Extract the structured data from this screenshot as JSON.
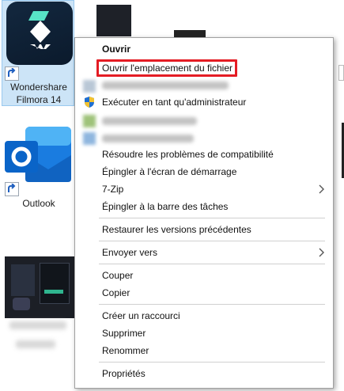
{
  "desktop": {
    "filmora": {
      "label_line1": "Wondershare",
      "label_line2": "Filmora 14"
    },
    "outlook": {
      "label": "Outlook"
    }
  },
  "menu": {
    "items": [
      {
        "label": "Ouvrir"
      },
      {
        "label": "Ouvrir l'emplacement du fichier"
      },
      {
        "label": "Exécuter en tant qu'administrateur"
      },
      {
        "label": "Résoudre les problèmes de compatibilité"
      },
      {
        "label": "Épingler à l'écran de démarrage"
      },
      {
        "label": "7-Zip"
      },
      {
        "label": "Épingler à la barre des tâches"
      },
      {
        "label": "Restaurer les versions précédentes"
      },
      {
        "label": "Envoyer vers"
      },
      {
        "label": "Couper"
      },
      {
        "label": "Copier"
      },
      {
        "label": "Créer un raccourci"
      },
      {
        "label": "Supprimer"
      },
      {
        "label": "Renommer"
      },
      {
        "label": "Propriétés"
      }
    ]
  },
  "colors": {
    "highlight": "#e41c24",
    "selection": "#cce4f7",
    "outlook": "#0a64c8"
  }
}
